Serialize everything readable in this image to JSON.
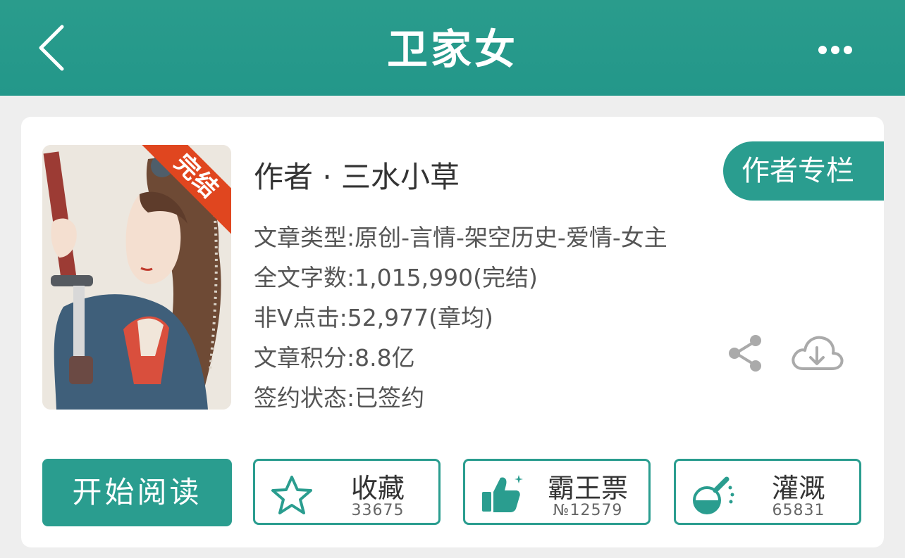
{
  "header": {
    "title": "卫家女"
  },
  "book": {
    "status_badge": "完结",
    "author_line": "作者 · 三水小草",
    "author_column_label": "作者专栏",
    "info": [
      "文章类型:原创-言情-架空历史-爱情-女主",
      "全文字数:1,015,990(完结)",
      "非V点击:52,977(章均)",
      "文章积分:8.8亿",
      "签约状态:已签约"
    ]
  },
  "actions": {
    "read_label": "开始阅读",
    "favorite": {
      "label": "收藏",
      "count": "33675",
      "icon": "star-icon"
    },
    "ticket": {
      "label": "霸王票",
      "count": "№12579",
      "icon": "thumbs-up-icon"
    },
    "nutrient": {
      "label": "灌溉",
      "count": "65831",
      "icon": "flask-icon"
    }
  },
  "colors": {
    "accent": "#2a9d8f",
    "badge": "#e0461f",
    "icon_gray": "#aaaaaa"
  }
}
